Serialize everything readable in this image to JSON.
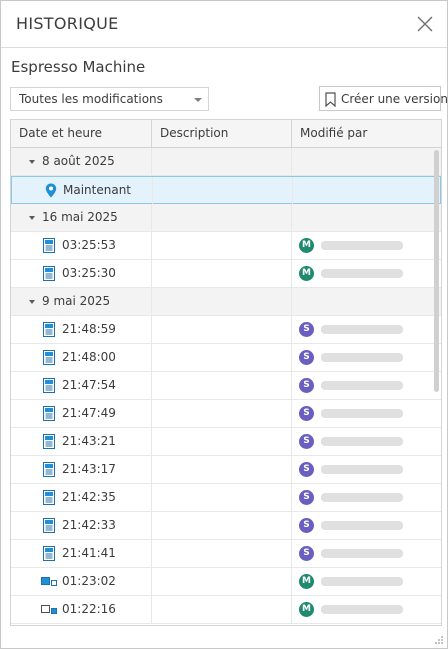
{
  "panel": {
    "title": "HISTORIQUE"
  },
  "document": {
    "name": "Espresso Machine"
  },
  "filter": {
    "selected": "Toutes les modifications"
  },
  "create_version": {
    "label": "Créer une version"
  },
  "table": {
    "columns": [
      "Date et heure",
      "Description",
      "Modifié par"
    ],
    "groups": [
      {
        "label": "8 août 2025",
        "rows": [
          {
            "time": "Maintenant",
            "icon": "location-pin-icon",
            "user_initial": "",
            "selected": true
          }
        ]
      },
      {
        "label": "16 mai 2025",
        "rows": [
          {
            "time": "03:25:53",
            "icon": "document-icon",
            "user_initial": "M"
          },
          {
            "time": "03:25:30",
            "icon": "document-icon",
            "user_initial": "M"
          }
        ]
      },
      {
        "label": "9 mai 2025",
        "rows": [
          {
            "time": "21:48:59",
            "icon": "document-icon",
            "user_initial": "S"
          },
          {
            "time": "21:48:00",
            "icon": "document-icon",
            "user_initial": "S"
          },
          {
            "time": "21:47:54",
            "icon": "document-icon",
            "user_initial": "S"
          },
          {
            "time": "21:47:49",
            "icon": "document-icon",
            "user_initial": "S"
          },
          {
            "time": "21:43:21",
            "icon": "document-icon",
            "user_initial": "S"
          },
          {
            "time": "21:43:17",
            "icon": "document-icon",
            "user_initial": "S"
          },
          {
            "time": "21:42:35",
            "icon": "document-icon",
            "user_initial": "S"
          },
          {
            "time": "21:42:33",
            "icon": "document-icon",
            "user_initial": "S"
          },
          {
            "time": "21:41:41",
            "icon": "document-icon",
            "user_initial": "S"
          },
          {
            "time": "01:23:02",
            "icon": "branch-version-icon",
            "user_initial": "M"
          },
          {
            "time": "01:22:16",
            "icon": "branch-version-icon-alt",
            "user_initial": "M"
          }
        ]
      }
    ]
  },
  "colors": {
    "accent": "#1f8fd6",
    "avatar_m": "#1f8a70",
    "avatar_s": "#6a5fc1",
    "selected_row": "#e4f2fb"
  }
}
